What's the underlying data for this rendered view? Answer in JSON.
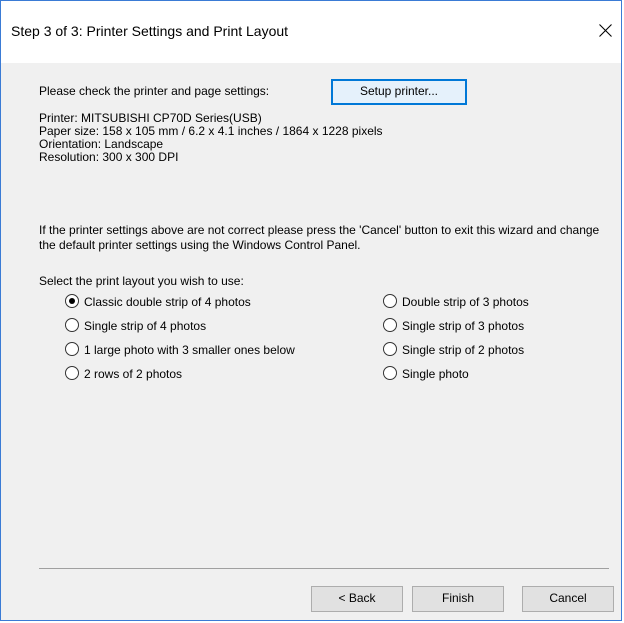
{
  "window": {
    "title": "Step 3 of 3: Printer Settings and Print Layout",
    "close_icon": "close-icon"
  },
  "setup": {
    "prompt": "Please check the printer and page settings:",
    "button_label": "Setup printer..."
  },
  "info": {
    "printer": "Printer: MITSUBISHI CP70D Series(USB)",
    "paper": "Paper size: 158 x 105 mm / 6.2 x 4.1 inches / 1864 x 1228 pixels",
    "orientation": "Orientation: Landscape",
    "resolution": "Resolution: 300 x 300 DPI"
  },
  "warning": "If the printer settings above are not correct please press the 'Cancel' button to exit this wizard and change the default printer settings using the Windows Control Panel.",
  "layout": {
    "label": "Select the print layout you wish to use:",
    "selected": "Classic double strip of 4 photos",
    "options": [
      "Classic double strip of 4 photos",
      "Single strip of 4 photos",
      "1 large photo with 3 smaller ones below",
      "2 rows of 2 photos",
      "Double strip of 3 photos",
      "Single strip of 3 photos",
      "Single strip of 2 photos",
      "Single photo"
    ]
  },
  "buttons": {
    "back": "< Back",
    "finish": "Finish",
    "cancel": "Cancel"
  },
  "colors": {
    "accent": "#0078d7",
    "client_background": "#f0f0f0",
    "window_border": "#3a7bd5"
  }
}
